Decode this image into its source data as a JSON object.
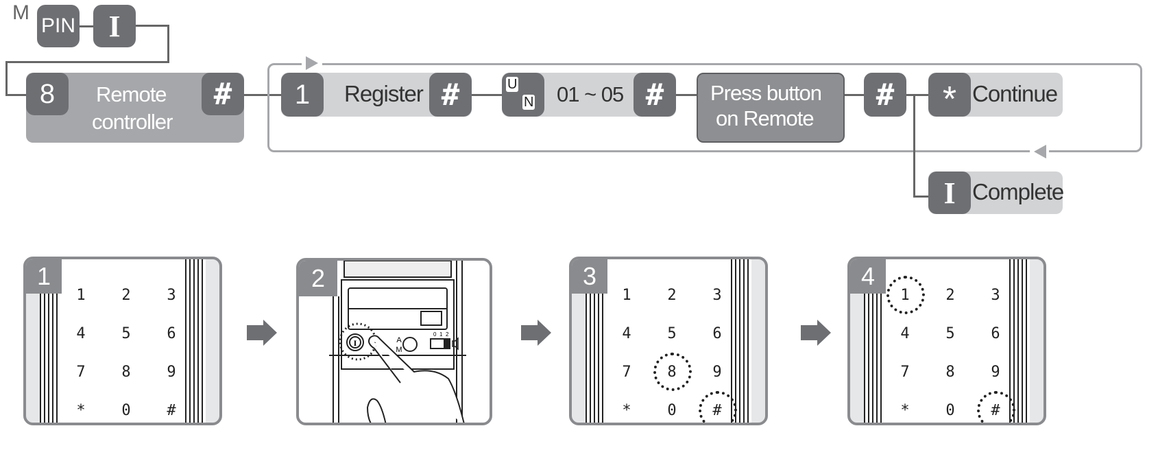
{
  "flow": {
    "mode_label": "M",
    "pin_key": "PIN",
    "confirm_key_1": "I",
    "step_key_8": "8",
    "remote_controller_label_line1": "Remote",
    "remote_controller_label_line2": "controller",
    "hash_key": "#",
    "step_key_1": "1",
    "register_label": "Register",
    "un_key_u": "U",
    "un_key_n": "N",
    "range_label": "01 ~ 05",
    "press_button_line1": "Press button",
    "press_button_line2": "on  Remote",
    "star_key": "*",
    "continue_label": "Continue",
    "complete_key": "I",
    "complete_label": "Complete"
  },
  "steps": [
    {
      "number": "1",
      "type": "keypad",
      "highlighted": []
    },
    {
      "number": "2",
      "type": "panel",
      "labels": {
        "a": "A",
        "m": "M",
        "switch_ticks": [
          "0",
          "1",
          "2"
        ]
      }
    },
    {
      "number": "3",
      "type": "keypad",
      "highlighted": [
        "8",
        "#"
      ]
    },
    {
      "number": "4",
      "type": "keypad",
      "highlighted": [
        "1",
        "#"
      ]
    }
  ],
  "keypad": [
    [
      "1",
      "2",
      "3"
    ],
    [
      "4",
      "5",
      "6"
    ],
    [
      "7",
      "8",
      "9"
    ],
    [
      "*",
      "0",
      "#"
    ]
  ],
  "colors": {
    "key_dark": "#6e6f73",
    "pill_light": "#d2d3d5",
    "pill_mid": "#a6a7aa",
    "frame": "#8a8b8e"
  }
}
